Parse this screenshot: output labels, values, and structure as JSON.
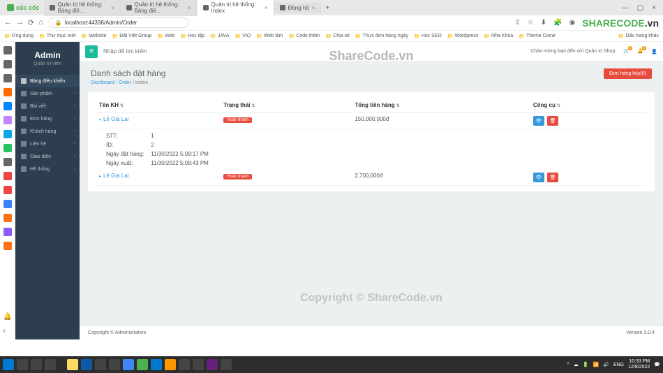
{
  "browser": {
    "name": "cốc cốc",
    "tabs": [
      {
        "label": "Quản trị hệ thống: Bảng điề…"
      },
      {
        "label": "Quản trị hệ thống: Bảng điề…"
      },
      {
        "label": "Quản trị hệ thống: Index"
      },
      {
        "label": "Đồng hồ"
      }
    ],
    "url": "localhost:44336/Admin/Order"
  },
  "bookmarks": [
    "Ứng dụng",
    "Thư mục mới",
    "Website",
    "Đất Việt Group",
    "Web",
    "Học tập",
    "JAVA",
    "VIO",
    "Web làm",
    "Code thêm",
    "Chia sẻ",
    "Thực đơn hàng ngày",
    "Học SEO",
    "Wordpress",
    "Nha Khoa",
    "Theme Clone"
  ],
  "bookmarks_last": "Dấu trang khác",
  "sidebar": {
    "title": "Admin",
    "subtitle": "Quản trị viên",
    "items": [
      {
        "label": "Bảng điều khiển",
        "active": true
      },
      {
        "label": "Sản phẩm"
      },
      {
        "label": "Bài viết"
      },
      {
        "label": "Đơn hàng"
      },
      {
        "label": "Khách hàng"
      },
      {
        "label": "Liên hệ"
      },
      {
        "label": "Giao diện"
      },
      {
        "label": "Hệ thống"
      }
    ]
  },
  "topbar": {
    "search_placeholder": "Nhập để tìm kiếm",
    "welcome": "Chào mừng bạn đến với Quản trị Shop."
  },
  "page_header": {
    "title": "Danh sách đặt hàng",
    "crumb1": "Dashboard",
    "crumb2": "Order",
    "crumb3": "Index",
    "cancel_btn": "Đơn hàng hủy(0)"
  },
  "table": {
    "headers": {
      "name": "Tên KH",
      "status": "Trạng thái",
      "total": "Tổng tiền hàng",
      "tools": "Công cụ"
    },
    "rows": [
      {
        "name": "Lê Gia Lai",
        "status": "Hoàn thành",
        "total": "150,000,000đ"
      },
      {
        "name": "Lê Gia Lai",
        "status": "Hoàn thành",
        "total": "2,700,000đ"
      }
    ],
    "detail": {
      "stt_label": "STT:",
      "stt": "1",
      "id_label": "ID:",
      "id": "2",
      "date_order_label": "Ngày đặt hàng:",
      "date_order": "11/30/2022 5:09:17 PM",
      "date_export_label": "Ngày xuất:",
      "date_export": "11/30/2022 5:09:43 PM"
    }
  },
  "footer": {
    "copyright": "Copyright © Administrators",
    "version": "Version 3.0.4"
  },
  "watermark": "ShareCode.vn",
  "watermark2": "Copyright © ShareCode.vn",
  "sharecode": {
    "share": "SHARECODE",
    "vn": ".vn"
  },
  "taskbar": {
    "lang": "ENG",
    "time": "10:33 PM",
    "date": "12/8/2022"
  }
}
